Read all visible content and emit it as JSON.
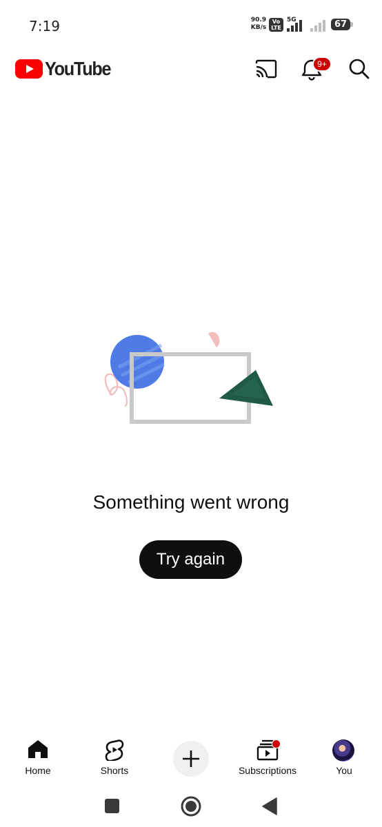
{
  "status_bar": {
    "time": "7:19",
    "net_speed_value": "90.9",
    "net_speed_unit": "KB/s",
    "volte_top": "Vo",
    "volte_bottom": "LTE",
    "network_type": "5G",
    "battery": "67"
  },
  "header": {
    "logo_text": "YouTube",
    "notification_count": "9+",
    "icons": [
      "cast-icon",
      "bell-icon",
      "search-icon"
    ]
  },
  "main": {
    "error_message": "Something went wrong",
    "retry_label": "Try again"
  },
  "bottom_nav": {
    "items": [
      {
        "label": "Home",
        "icon": "home-icon"
      },
      {
        "label": "Shorts",
        "icon": "shorts-icon"
      },
      {
        "label": "",
        "icon": "plus-icon"
      },
      {
        "label": "Subscriptions",
        "icon": "subscriptions-icon"
      },
      {
        "label": "You",
        "icon": "avatar"
      }
    ]
  },
  "system_nav": {
    "icons": [
      "recents-square-icon",
      "home-circle-icon",
      "back-triangle-icon"
    ]
  },
  "colors": {
    "brand_red": "#ff0000",
    "badge_red": "#cc0000",
    "text": "#0f0f0f",
    "illustration_blue": "#4f7be6",
    "illustration_green": "#1e5a46",
    "illustration_pink": "#f4bcbc",
    "illustration_gray": "#c9c9c9"
  }
}
